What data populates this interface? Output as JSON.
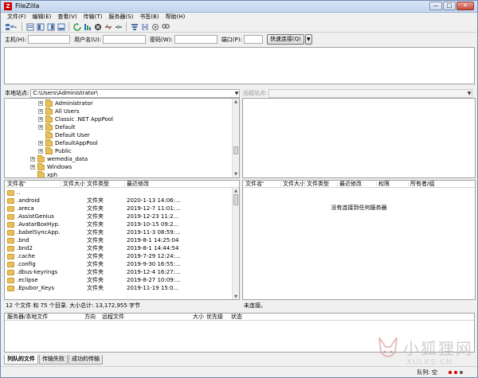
{
  "window": {
    "title": "FileZilla",
    "minimize": "—",
    "maximize": "□",
    "close": "✕"
  },
  "menu": [
    "文件(F)",
    "编辑(E)",
    "查看(V)",
    "传输(T)",
    "服务器(S)",
    "书签(B)",
    "帮助(H)"
  ],
  "quickconnect": {
    "host_label": "主机(H):",
    "user_label": "用户名(U):",
    "pass_label": "密码(W):",
    "port_label": "端口(P):",
    "button": "快速连接(Q)"
  },
  "local": {
    "site_label": "本地站点:",
    "path": "C:\\Users\\Administrator\\",
    "tree": [
      {
        "label": "Administrator",
        "level": 1
      },
      {
        "label": "All Users",
        "level": 1
      },
      {
        "label": "Classic .NET AppPool",
        "level": 1
      },
      {
        "label": "Default",
        "level": 1
      },
      {
        "label": "Default User",
        "level": 1
      },
      {
        "label": "DefaultAppPool",
        "level": 1
      },
      {
        "label": "Public",
        "level": 1
      },
      {
        "label": "wemedia_data",
        "level": 0
      },
      {
        "label": "Windows",
        "level": 0
      },
      {
        "label": "xph",
        "level": 0
      }
    ],
    "columns": [
      "文件名",
      "文件大小",
      "文件类型",
      "最近修改"
    ],
    "files": [
      {
        "name": "..",
        "type": "",
        "modified": ""
      },
      {
        "name": ".android",
        "type": "文件夹",
        "modified": "2020-1-13 14:06:..."
      },
      {
        "name": ".areca",
        "type": "文件夹",
        "modified": "2019-12-7 11:01:..."
      },
      {
        "name": ".AssistGenius",
        "type": "文件夹",
        "modified": "2019-12-23 11:2..."
      },
      {
        "name": ".AvatarBoxHyp...",
        "type": "文件夹",
        "modified": "2019-10-15 09:2..."
      },
      {
        "name": ".babelSyncApp...",
        "type": "文件夹",
        "modified": "2019-11-3 08:59:..."
      },
      {
        "name": ".bnd",
        "type": "文件夹",
        "modified": "2019-8-1 14:25:04"
      },
      {
        "name": ".bnd2",
        "type": "文件夹",
        "modified": "2019-8-1 14:44:54"
      },
      {
        "name": ".cache",
        "type": "文件夹",
        "modified": "2019-7-29 12:24:..."
      },
      {
        "name": ".config",
        "type": "文件夹",
        "modified": "2019-9-30 16:55:..."
      },
      {
        "name": ".dbus-keyrings",
        "type": "文件夹",
        "modified": "2019-12-4 16:27:..."
      },
      {
        "name": ".eclipse",
        "type": "文件夹",
        "modified": "2019-8-27 10:09:..."
      },
      {
        "name": ".Epubor_Keys",
        "type": "文件夹",
        "modified": "2019-11-19 15:0..."
      }
    ],
    "status": "12 个文件 和 75 个目录. 大小总计: 13,172,955 字节"
  },
  "remote": {
    "site_label": "远程站点:",
    "path": "",
    "columns": [
      "文件名",
      "文件大小",
      "文件类型",
      "最近修改",
      "权限",
      "所有者/组"
    ],
    "empty_message": "没有连接到任何服务器",
    "status": "未连接。"
  },
  "queue": {
    "columns": [
      "服务器/本地文件",
      "方向",
      "远程文件",
      "大小",
      "优先级",
      "状态"
    ],
    "tabs": [
      "列队的文件",
      "传输失败",
      "成功的传输"
    ],
    "status": "队列: 空"
  },
  "watermark": {
    "text": "小狐狸网",
    "sub": "XULKS.CN"
  },
  "colors": {
    "folder": "#e8c15a",
    "title_bar": "#c3d5ee",
    "dot_red": "#d00000",
    "dot_grey": "#555555"
  }
}
